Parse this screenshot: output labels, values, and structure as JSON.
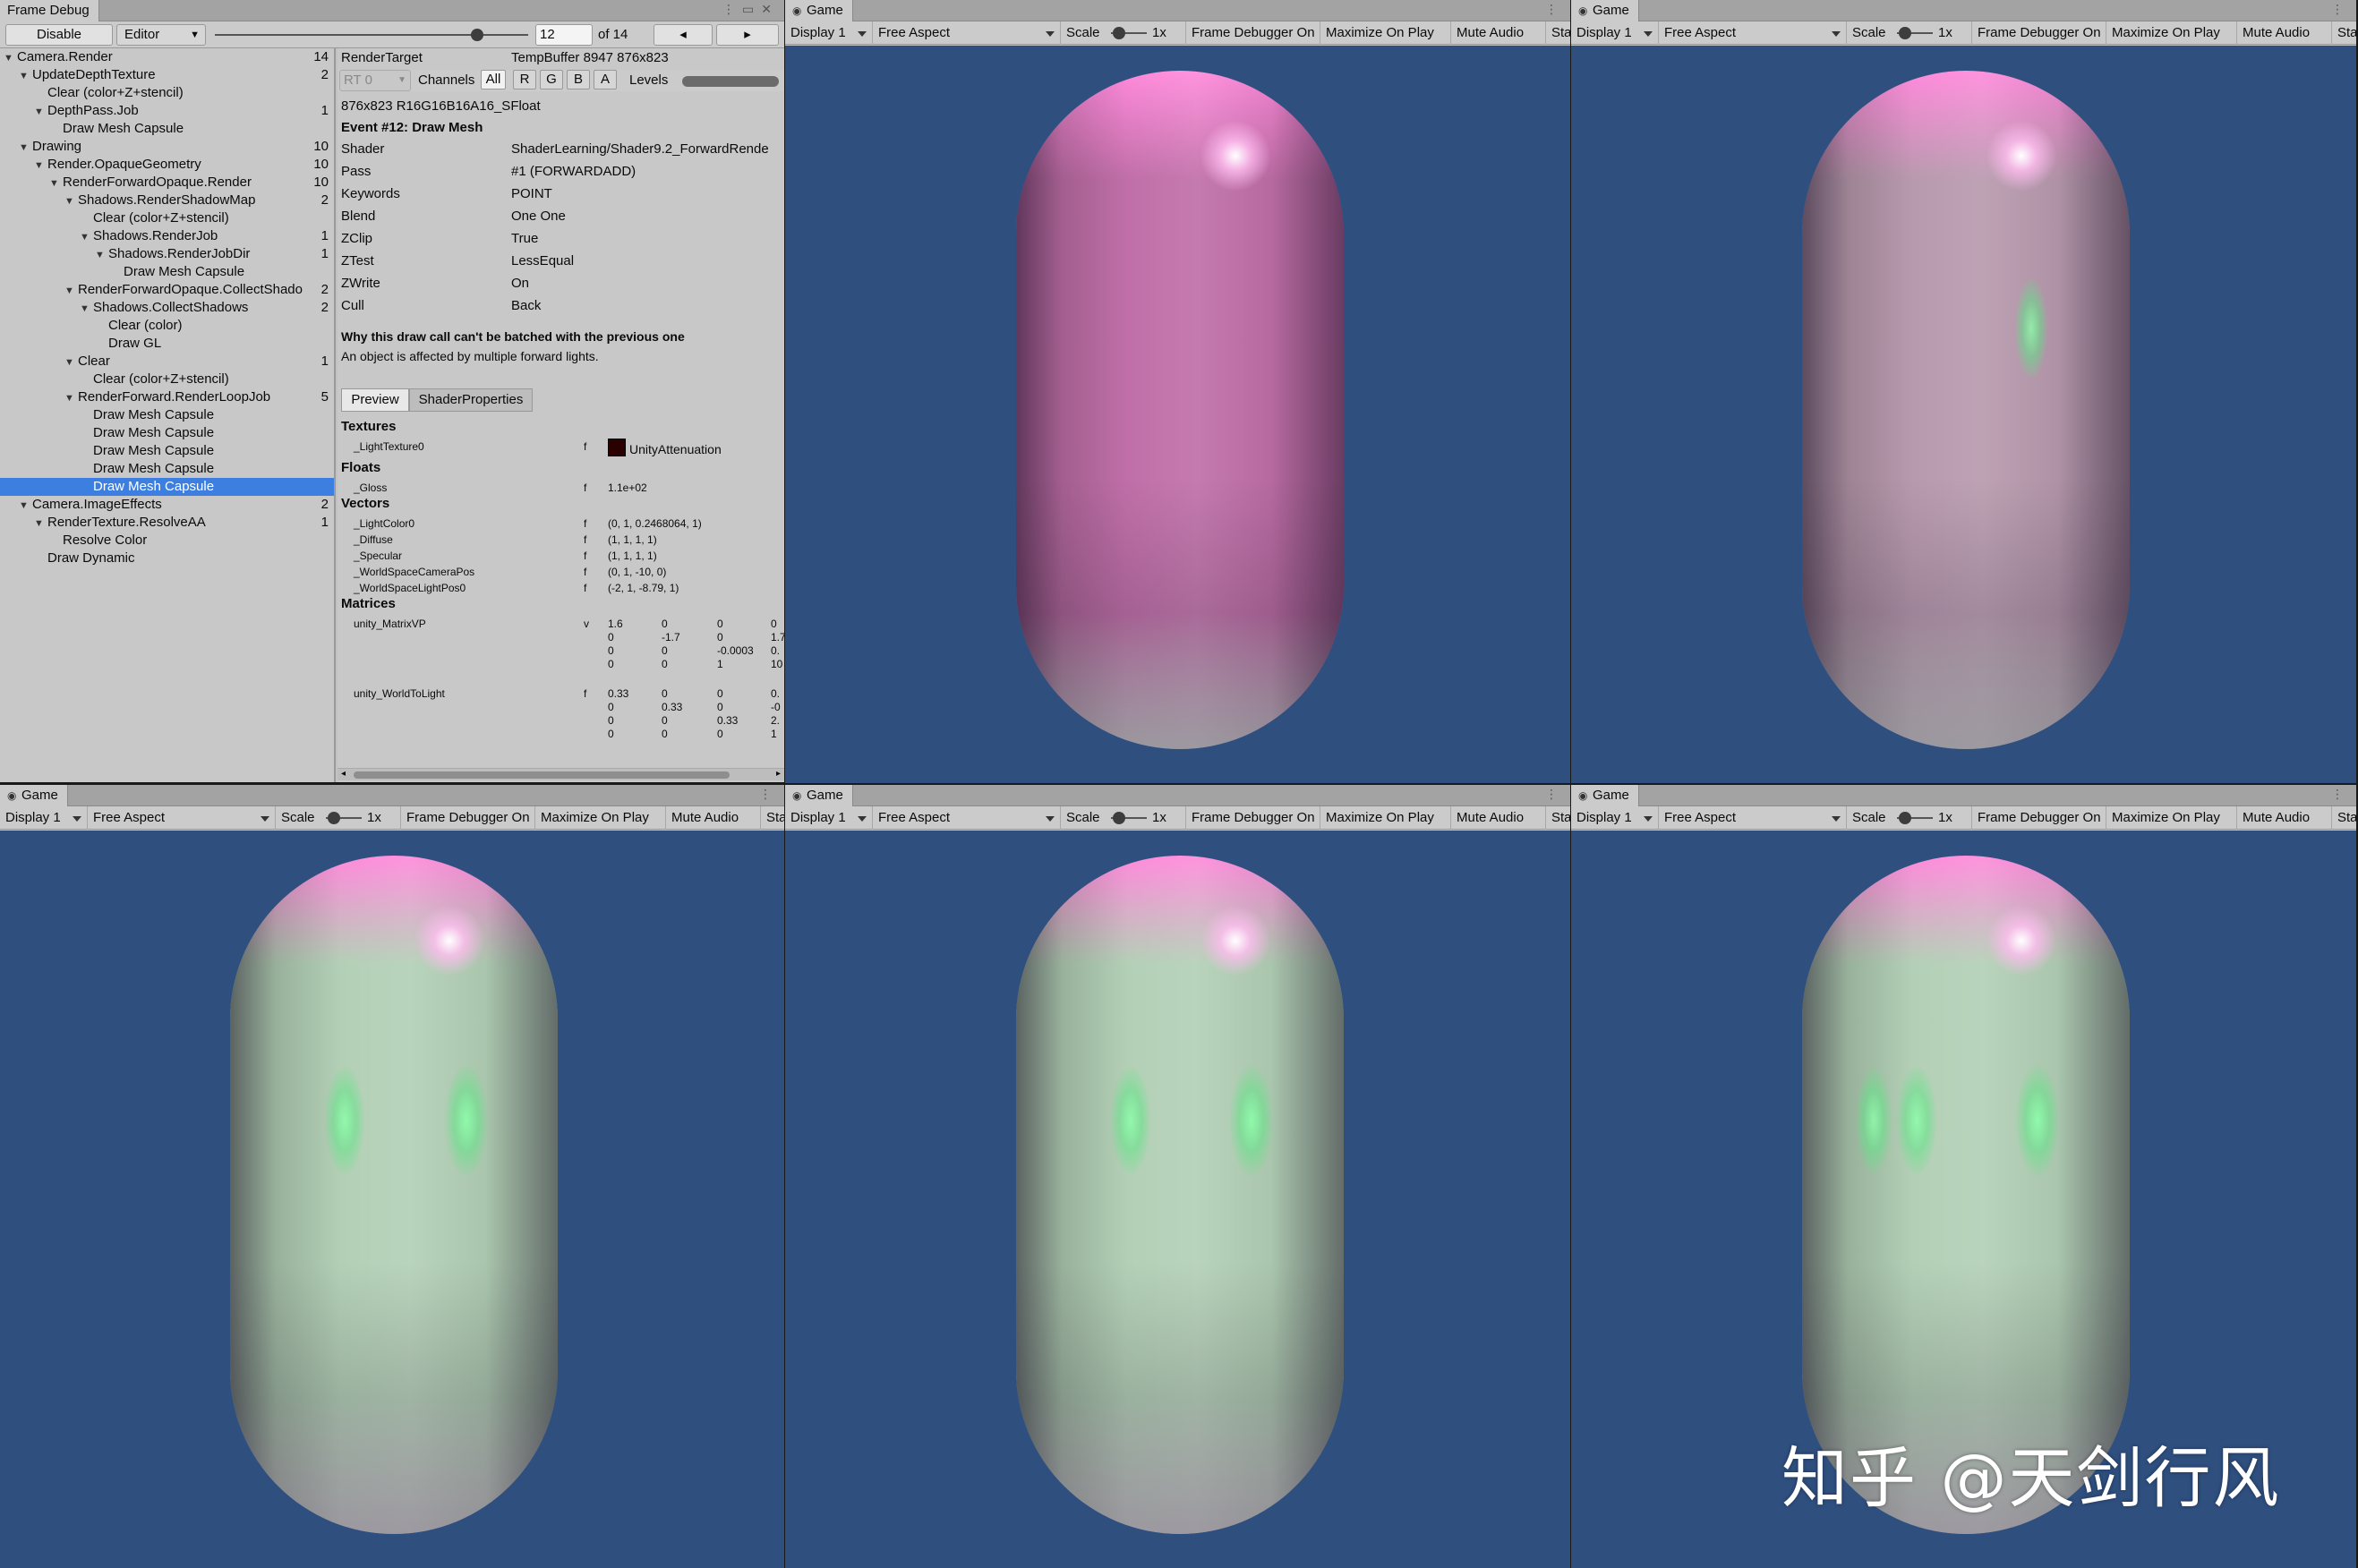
{
  "frame_debug": {
    "tab_title": "Frame Debug",
    "disable_label": "Disable",
    "mode_label": "Editor",
    "event_index": "12",
    "event_total": "of 14",
    "prev_icon": "◂",
    "next_icon": "▸",
    "tree": [
      {
        "label": "Camera.Render",
        "count": "14",
        "level": 0,
        "expander": true
      },
      {
        "label": "UpdateDepthTexture",
        "count": "2",
        "level": 1,
        "expander": true
      },
      {
        "label": "Clear (color+Z+stencil)",
        "count": "",
        "level": 2,
        "expander": false
      },
      {
        "label": "DepthPass.Job",
        "count": "1",
        "level": 2,
        "expander": true
      },
      {
        "label": "Draw Mesh Capsule",
        "count": "",
        "level": 3,
        "expander": false
      },
      {
        "label": "Drawing",
        "count": "10",
        "level": 1,
        "expander": true
      },
      {
        "label": "Render.OpaqueGeometry",
        "count": "10",
        "level": 2,
        "expander": true
      },
      {
        "label": "RenderForwardOpaque.Render",
        "count": "10",
        "level": 3,
        "expander": true
      },
      {
        "label": "Shadows.RenderShadowMap",
        "count": "2",
        "level": 4,
        "expander": true
      },
      {
        "label": "Clear (color+Z+stencil)",
        "count": "",
        "level": 5,
        "expander": false
      },
      {
        "label": "Shadows.RenderJob",
        "count": "1",
        "level": 5,
        "expander": true
      },
      {
        "label": "Shadows.RenderJobDir",
        "count": "1",
        "level": 6,
        "expander": true
      },
      {
        "label": "Draw Mesh Capsule",
        "count": "",
        "level": 7,
        "expander": false
      },
      {
        "label": "RenderForwardOpaque.CollectShado",
        "count": "2",
        "level": 4,
        "expander": true
      },
      {
        "label": "Shadows.CollectShadows",
        "count": "2",
        "level": 5,
        "expander": true
      },
      {
        "label": "Clear (color)",
        "count": "",
        "level": 6,
        "expander": false
      },
      {
        "label": "Draw GL",
        "count": "",
        "level": 6,
        "expander": false
      },
      {
        "label": "Clear",
        "count": "1",
        "level": 4,
        "expander": true
      },
      {
        "label": "Clear (color+Z+stencil)",
        "count": "",
        "level": 5,
        "expander": false
      },
      {
        "label": "RenderForward.RenderLoopJob",
        "count": "5",
        "level": 4,
        "expander": true
      },
      {
        "label": "Draw Mesh Capsule",
        "count": "",
        "level": 5,
        "expander": false
      },
      {
        "label": "Draw Mesh Capsule",
        "count": "",
        "level": 5,
        "expander": false
      },
      {
        "label": "Draw Mesh Capsule",
        "count": "",
        "level": 5,
        "expander": false
      },
      {
        "label": "Draw Mesh Capsule",
        "count": "",
        "level": 5,
        "expander": false
      },
      {
        "label": "Draw Mesh Capsule",
        "count": "",
        "level": 5,
        "expander": false,
        "selected": true
      },
      {
        "label": "Camera.ImageEffects",
        "count": "2",
        "level": 1,
        "expander": true
      },
      {
        "label": "RenderTexture.ResolveAA",
        "count": "1",
        "level": 2,
        "expander": true
      },
      {
        "label": "Resolve Color",
        "count": "",
        "level": 3,
        "expander": false
      },
      {
        "label": "Draw Dynamic",
        "count": "",
        "level": 2,
        "expander": false
      }
    ],
    "render_target_label": "RenderTarget",
    "render_target_value": "TempBuffer 8947 876x823",
    "rt_select": "RT 0",
    "channels_label": "Channels",
    "channels": [
      "All",
      "R",
      "G",
      "B",
      "A"
    ],
    "levels_label": "Levels",
    "format": "876x823 R16G16B16A16_SFloat",
    "event_title": "Event #12: Draw Mesh",
    "props": [
      {
        "k": "Shader",
        "v": "ShaderLearning/Shader9.2_ForwardRende"
      },
      {
        "k": "Pass",
        "v": "#1 (FORWARDADD)"
      },
      {
        "k": "Keywords",
        "v": "POINT"
      },
      {
        "k": "Blend",
        "v": "One One"
      },
      {
        "k": "ZClip",
        "v": "True"
      },
      {
        "k": "ZTest",
        "v": "LessEqual"
      },
      {
        "k": "ZWrite",
        "v": "On"
      },
      {
        "k": "Cull",
        "v": "Back"
      }
    ],
    "batch_title": "Why this draw call can't be batched with the previous one",
    "batch_reason": "An object is affected by multiple forward lights.",
    "tabs": [
      "Preview",
      "ShaderProperties"
    ],
    "textures_header": "Textures",
    "texture": {
      "name": "_LightTexture0",
      "flag": "f",
      "value": "UnityAttenuation"
    },
    "floats_header": "Floats",
    "floats": [
      {
        "name": "_Gloss",
        "flag": "f",
        "value": "1.1e+02"
      }
    ],
    "vectors_header": "Vectors",
    "vectors": [
      {
        "name": "_LightColor0",
        "flag": "f",
        "value": "(0, 1, 0.2468064, 1)"
      },
      {
        "name": "_Diffuse",
        "flag": "f",
        "value": "(1, 1, 1, 1)"
      },
      {
        "name": "_Specular",
        "flag": "f",
        "value": "(1, 1, 1, 1)"
      },
      {
        "name": "_WorldSpaceCameraPos",
        "flag": "f",
        "value": "(0, 1, -10, 0)"
      },
      {
        "name": "_WorldSpaceLightPos0",
        "flag": "f",
        "value": "(-2, 1, -8.79, 1)"
      }
    ],
    "matrices_header": "Matrices",
    "matrices": [
      {
        "name": "unity_MatrixVP",
        "flag": "v",
        "rows": [
          [
            "1.6",
            "0",
            "0",
            "0"
          ],
          [
            "0",
            "-1.7",
            "0",
            "1.7"
          ],
          [
            "0",
            "0",
            "-0.0003",
            "0."
          ],
          [
            "0",
            "0",
            "1",
            "10"
          ]
        ]
      },
      {
        "name": "unity_WorldToLight",
        "flag": "f",
        "rows": [
          [
            "0.33",
            "0",
            "0",
            "0."
          ],
          [
            "0",
            "0.33",
            "0",
            "-0"
          ],
          [
            "0",
            "0",
            "0.33",
            "2."
          ],
          [
            "0",
            "0",
            "0",
            "1"
          ]
        ]
      }
    ]
  },
  "game_views": [
    {
      "tab": "Game",
      "display": "Display 1",
      "aspect": "Free Aspect",
      "scale_label": "Scale",
      "scale_value": "1x",
      "frame_debugger": "Frame Debugger On",
      "maximize": "Maximize On Play",
      "mute": "Mute Audio",
      "stats": "Stat",
      "green_spots": 0
    },
    {
      "tab": "Game",
      "display": "Display 1",
      "aspect": "Free Aspect",
      "scale_label": "Scale",
      "scale_value": "1x",
      "frame_debugger": "Frame Debugger On",
      "maximize": "Maximize On Play",
      "mute": "Mute Audio",
      "stats": "Stat",
      "green_spots": 1
    },
    {
      "tab": "Game",
      "display": "Display 1",
      "aspect": "Free Aspect",
      "scale_label": "Scale",
      "scale_value": "1x",
      "frame_debugger": "Frame Debugger On",
      "maximize": "Maximize On Play",
      "mute": "Mute Audio",
      "stats": "Stat",
      "green_spots": 2
    },
    {
      "tab": "Game",
      "display": "Display 1",
      "aspect": "Free Aspect",
      "scale_label": "Scale",
      "scale_value": "1x",
      "frame_debugger": "Frame Debugger On",
      "maximize": "Maximize On Play",
      "mute": "Mute Audio",
      "stats": "Stat",
      "green_spots": 2
    },
    {
      "tab": "Game",
      "display": "Display 1",
      "aspect": "Free Aspect",
      "scale_label": "Scale",
      "scale_value": "1x",
      "frame_debugger": "Frame Debugger On",
      "maximize": "Maximize On Play",
      "mute": "Mute Audio",
      "stats": "Stat",
      "green_spots": 3
    }
  ],
  "watermark": "知乎 @天剑行风",
  "colors": {
    "viewport_bg": "#2f4f7f",
    "selection": "#3d7fe0",
    "capsule_pink": "#c06fa8",
    "capsule_green": "#b9dcbd",
    "spec_green": "#7dffa0"
  }
}
